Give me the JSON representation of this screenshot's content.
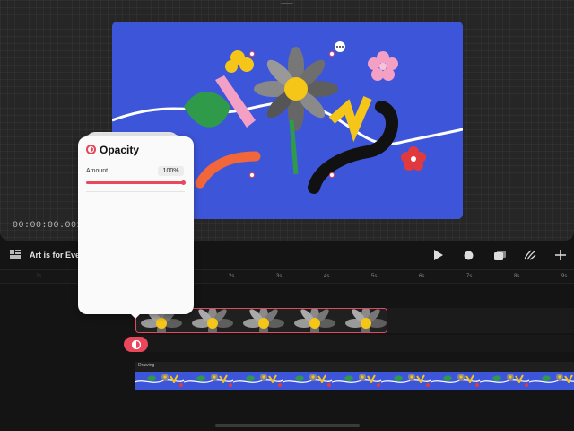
{
  "preview": {
    "timecode": "00:00:00.001"
  },
  "toolbar": {
    "project_title": "Art is for Eve"
  },
  "ruler": {
    "ticks": [
      "2s",
      "2s",
      "3s",
      "4s",
      "5s",
      "6s",
      "7s",
      "8s",
      "9s"
    ]
  },
  "tracks": {
    "drawing_label": "Drawing"
  },
  "opacity_panel": {
    "title": "Opacity",
    "amount_label": "Amount",
    "amount_value": "100%",
    "amount_fraction": 1.0
  },
  "colors": {
    "accent": "#e9475b",
    "canvas_blue": "#3d56d9",
    "leaf_green": "#2f9a4a",
    "yellow": "#f5c518",
    "pink": "#f3a0c4",
    "orange": "#f2663c"
  },
  "icons": {
    "layers": "layers-icon",
    "play": "play-icon",
    "record": "record-icon",
    "stack": "clip-stack-icon",
    "draw": "draw-icon",
    "add": "plus-icon"
  }
}
